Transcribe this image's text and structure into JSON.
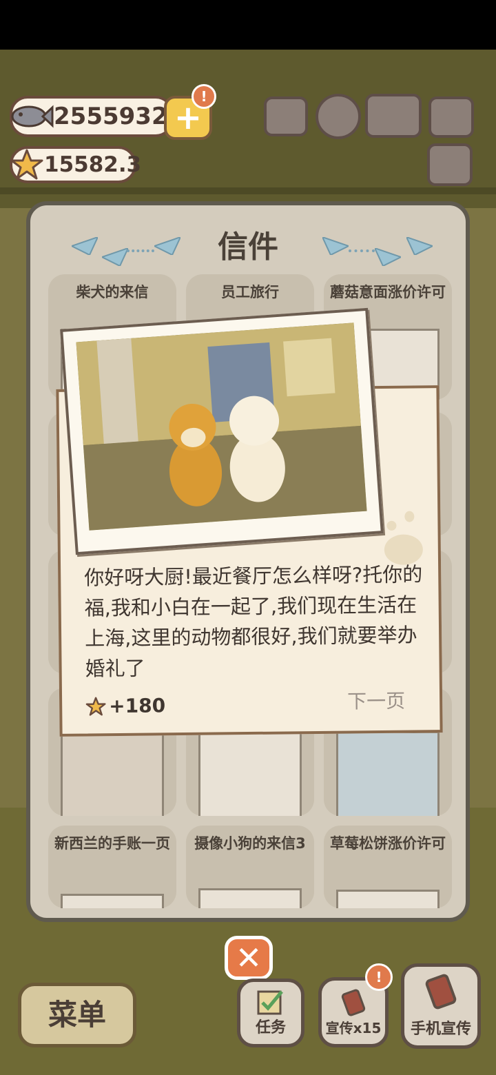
{
  "currency": {
    "fish": "2555932",
    "stars": "15582.3",
    "alert_badge": "!"
  },
  "modal": {
    "title": "信件",
    "cards": [
      {
        "title": "柴犬的来信"
      },
      {
        "title": "员工旅行"
      },
      {
        "title": "蘑菇意面涨价许可"
      },
      {
        "title": ""
      },
      {
        "title": ""
      },
      {
        "title": ""
      },
      {
        "title": "新西兰的手账一页"
      },
      {
        "title": "摄像小狗的来信3"
      },
      {
        "title": "草莓松饼涨价许可"
      }
    ]
  },
  "letter": {
    "text": "你好呀大厨!最近餐厅怎么样呀?托你的福,我和小白在一起了,我们现在生活在上海,这里的动物都很好,我们就要举办婚礼了",
    "reward": "+180",
    "next": "下一页"
  },
  "bottom": {
    "close": "✕",
    "menu": "菜单",
    "task": "任务",
    "promo": "宣传x15",
    "phone": "手机宣传",
    "alert": "!"
  },
  "colors": {
    "accent_orange": "#e67a48",
    "gold": "#f3c94f",
    "paper": "#f7eedd",
    "outline": "#6a4b3c"
  }
}
